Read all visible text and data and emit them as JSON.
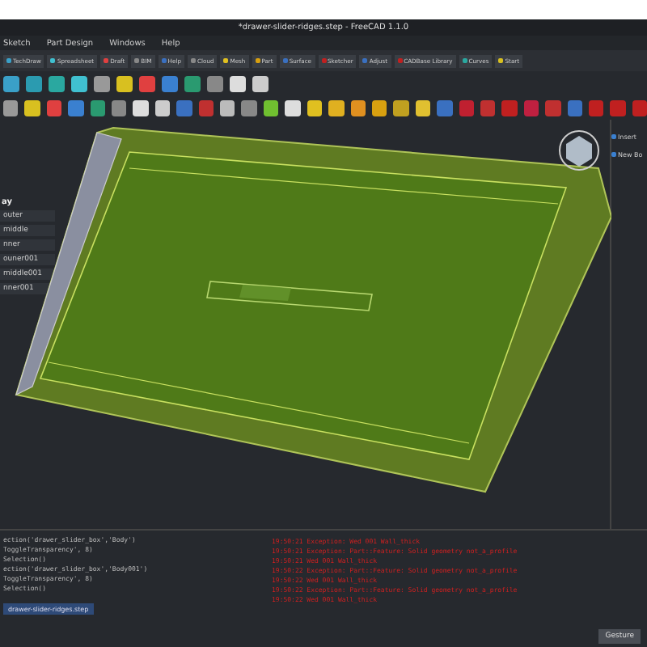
{
  "window": {
    "title": "*drawer-slider-ridges.step - FreeCAD 1.1.0"
  },
  "menu": [
    "Sketch",
    "Part Design",
    "Windows",
    "Help"
  ],
  "workbenches": [
    "TechDraw",
    "Spreadsheet",
    "Draft",
    "BIM",
    "Help",
    "Cloud",
    "Mesh",
    "Part",
    "Surface",
    "Sketcher",
    "Adjust",
    "CADBase Library",
    "Curves",
    "Start"
  ],
  "tree": {
    "title": "ay",
    "items": [
      "outer",
      "middle",
      "nner",
      "ouner001",
      "middle001",
      "nner001"
    ]
  },
  "tasks": [
    "Insert",
    "New Bo"
  ],
  "python_console": [
    "ection('drawer_slider_box','Body')",
    "ToggleTransparency', 8)",
    "Selection()",
    "ection('drawer_slider_box','Body001')",
    "ToggleTransparency', 8)",
    "Selection()"
  ],
  "document_tab": "drawer-slider-ridges.step",
  "report": [
    "19:50:21  Exception: Wed 001 Wall_thick",
    "19:50:21  Exception: Part::Feature: Solid geometry not_a_profile",
    "19:50:21  Wed 001 Wall_thick",
    "19:50:22  Exception: Part::Feature: Solid geometry not_a_profile",
    "19:50:22  Wed 001 Wall_thick",
    "19:50:22  Exception: Part::Feature: Solid geometry not_a_profile",
    "19:50:22  Wed 001 Wall_thick"
  ],
  "navigation": "Gesture"
}
